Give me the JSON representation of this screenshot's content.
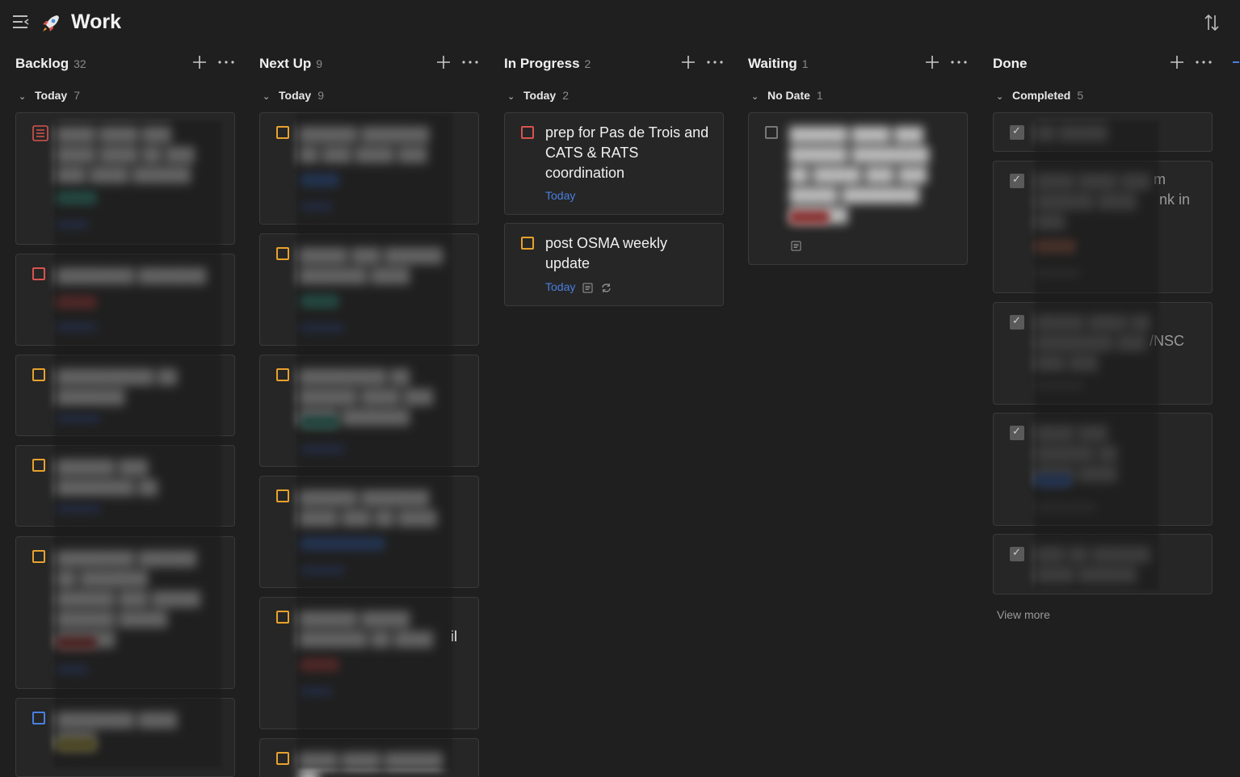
{
  "app": {
    "title": "Work"
  },
  "columns": [
    {
      "title": "Backlog",
      "count": "32",
      "group": {
        "label": "Today",
        "count": "7"
      }
    },
    {
      "title": "Next Up",
      "count": "9",
      "group": {
        "label": "Today",
        "count": "9"
      }
    },
    {
      "title": "In Progress",
      "count": "2",
      "group": {
        "label": "Today",
        "count": "2"
      }
    },
    {
      "title": "Waiting",
      "count": "1",
      "group": {
        "label": "No Date",
        "count": "1"
      }
    },
    {
      "title": "Done",
      "count": "",
      "group": {
        "label": "Completed",
        "count": "5"
      }
    }
  ],
  "in_progress_tasks": [
    {
      "text": "prep for Pas de Trois and CATS & RATS coordination",
      "due": "Today"
    },
    {
      "text": "post OSMA weekly update",
      "due": "Today"
    }
  ],
  "done_visible_fragments": [
    "m",
    "nk in",
    "/NSC"
  ],
  "next_up_fragment": "il",
  "done_footer": {
    "view_more": "View more"
  },
  "colors": {
    "background": "#1f1f1f",
    "card": "#262626",
    "due_blue": "#4a7fe0",
    "priority_orange": "#e8a22c",
    "priority_red": "#d9534f"
  },
  "icons": [
    "menu-icon",
    "rocket-icon",
    "sort-icon",
    "plus-icon",
    "more-icon",
    "chevron-down-icon",
    "note-icon",
    "repeat-icon",
    "checkbox-icon"
  ]
}
